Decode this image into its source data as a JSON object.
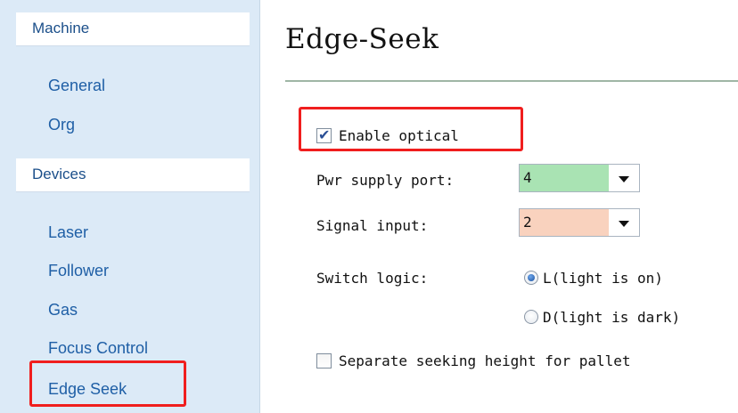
{
  "sidebar": {
    "sections": [
      {
        "label": "Machine",
        "items": [
          "General",
          "Org"
        ]
      },
      {
        "label": "Devices",
        "items": [
          "Laser",
          "Follower",
          "Gas",
          "Focus Control",
          "Edge Seek"
        ]
      }
    ],
    "selected": "Edge Seek"
  },
  "page": {
    "title": "Edge-Seek",
    "enable_optical": {
      "label": "Enable optical",
      "checked": true
    },
    "pwr_supply_port": {
      "label": "Pwr supply port:",
      "value": "4",
      "color": "#a9e3b3"
    },
    "signal_input": {
      "label": "Signal input:",
      "value": "2",
      "color": "#f9d2be"
    },
    "switch_logic": {
      "label": "Switch logic:",
      "options": [
        "L(light is on)",
        "D(light is dark)"
      ],
      "selected": "L(light is on)"
    },
    "separate_seek": {
      "label": "Separate seeking height for pallet",
      "checked": false
    }
  },
  "colors": {
    "highlight": "#f01e1e",
    "sidebar_bg": "#dceaf7",
    "nav_text": "#1f5fa6"
  }
}
